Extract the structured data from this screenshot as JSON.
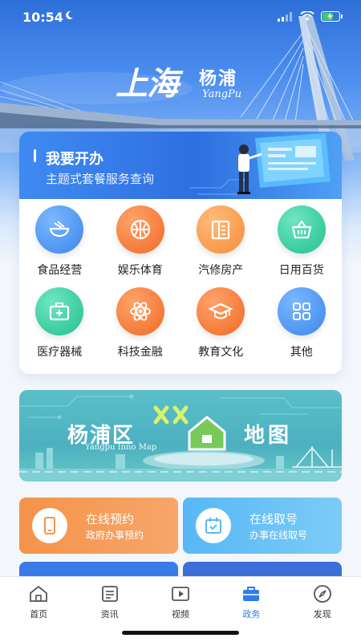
{
  "status_bar": {
    "time": "10:54"
  },
  "logo": {
    "calligraphy": "上海",
    "name": "杨浦",
    "name_en": "YangPu"
  },
  "service": {
    "banner_title": "我要开办",
    "banner_subtitle": "主题式套餐服务查询",
    "items": [
      {
        "label": "食品经营",
        "icon": "food-bowl-icon",
        "color": "#4a9bf0"
      },
      {
        "label": "娱乐体育",
        "icon": "basketball-icon",
        "color": "#f5813a"
      },
      {
        "label": "汽修房产",
        "icon": "building-icon",
        "color": "#f59a4a"
      },
      {
        "label": "日用百货",
        "icon": "shopping-basket-icon",
        "color": "#3ecda3"
      },
      {
        "label": "医疗器械",
        "icon": "medical-kit-icon",
        "color": "#3ecda3"
      },
      {
        "label": "科技金融",
        "icon": "atom-icon",
        "color": "#f5813a"
      },
      {
        "label": "教育文化",
        "icon": "graduation-cap-icon",
        "color": "#f5813a"
      },
      {
        "label": "其他",
        "icon": "grid-apps-icon",
        "color": "#4a9bf0"
      }
    ]
  },
  "map_banner": {
    "title_left": "杨浦区",
    "title_right": "地图",
    "subtitle_en": "Yangpu Inno Map"
  },
  "appointments": [
    {
      "title": "在线预约",
      "subtitle": "政府办事预约"
    },
    {
      "title": "在线取号",
      "subtitle": "办事在线取号"
    }
  ],
  "tabbar": {
    "tabs": [
      {
        "label": "首页",
        "icon": "home-icon"
      },
      {
        "label": "资讯",
        "icon": "news-icon"
      },
      {
        "label": "视频",
        "icon": "video-icon"
      },
      {
        "label": "政务",
        "icon": "briefcase-icon",
        "active": true
      },
      {
        "label": "发现",
        "icon": "compass-icon"
      }
    ]
  }
}
